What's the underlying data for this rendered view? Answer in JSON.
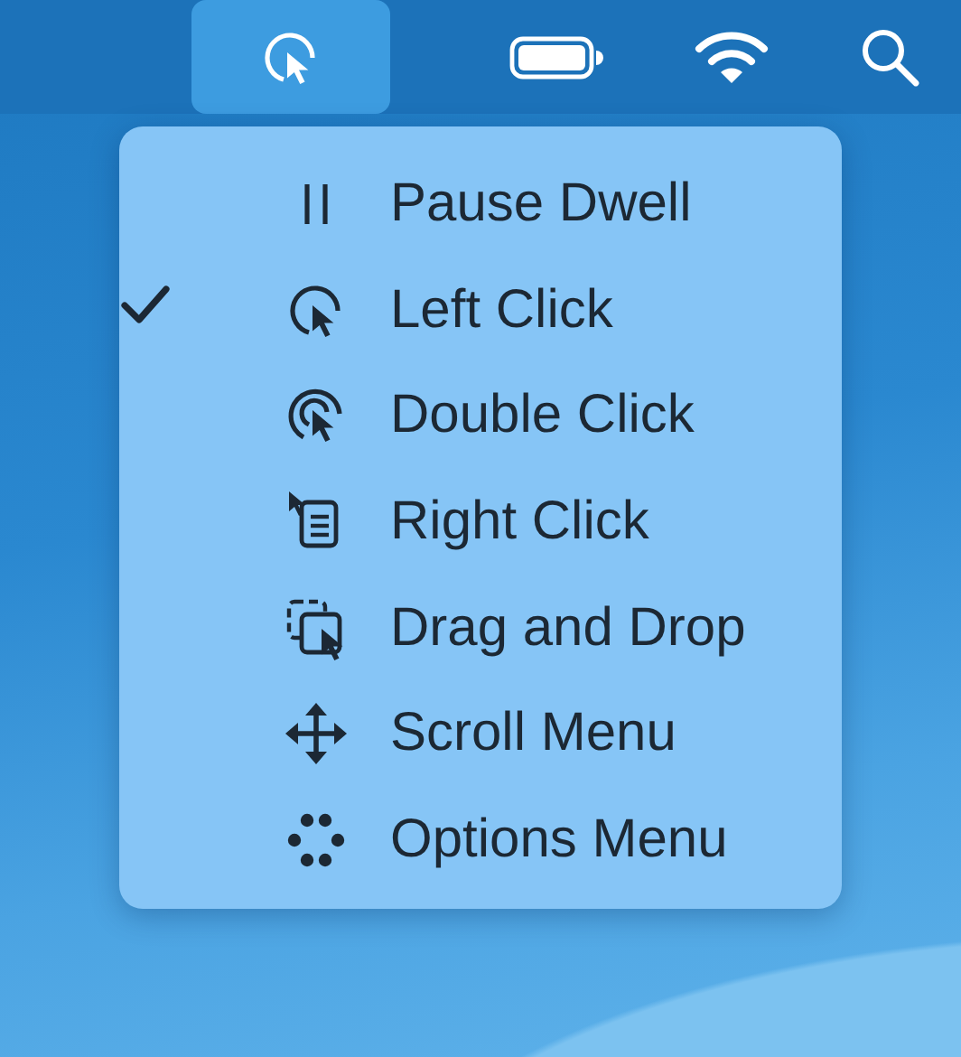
{
  "menu_bar": {
    "items": [
      {
        "kind": "dwell",
        "selected": true
      },
      {
        "kind": "battery",
        "selected": false
      },
      {
        "kind": "wifi",
        "selected": false
      },
      {
        "kind": "search",
        "selected": false
      }
    ]
  },
  "menu": {
    "items": [
      {
        "kind": "pause",
        "label": "Pause Dwell",
        "checked": false
      },
      {
        "kind": "left-click",
        "label": "Left Click",
        "checked": true
      },
      {
        "kind": "double-click",
        "label": "Double Click",
        "checked": false
      },
      {
        "kind": "right-click",
        "label": "Right Click",
        "checked": false
      },
      {
        "kind": "drag",
        "label": "Drag and Drop",
        "checked": false
      },
      {
        "kind": "scroll",
        "label": "Scroll Menu",
        "checked": false
      },
      {
        "kind": "options",
        "label": "Options Menu",
        "checked": false
      }
    ]
  }
}
